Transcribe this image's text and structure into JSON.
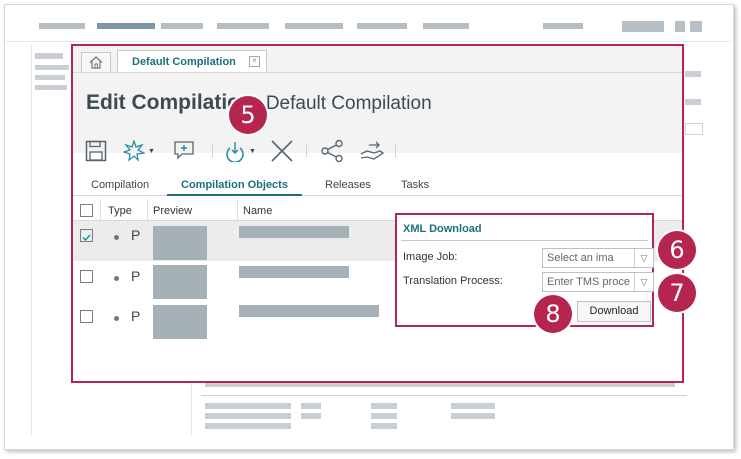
{
  "dialog": {
    "tab_label": "Default Compilation",
    "title_prefix": "Edit Compilation:",
    "title_name": "Default Compilation"
  },
  "toolbar": {
    "icons": [
      "save-icon",
      "new-icon",
      "comment-icon",
      "download-icon",
      "delete-icon",
      "share-icon",
      "handover-icon"
    ]
  },
  "tabs": [
    "Compilation",
    "Compilation Objects",
    "Releases",
    "Tasks"
  ],
  "active_tab": "Compilation Objects",
  "grid": {
    "columns": [
      "Type",
      "Preview",
      "Name"
    ],
    "rows": [
      {
        "checked": true,
        "type": "P"
      },
      {
        "checked": false,
        "type": "P"
      },
      {
        "checked": false,
        "type": "P"
      }
    ]
  },
  "xml_download": {
    "title": "XML Download",
    "image_job_label": "Image Job:",
    "image_job_placeholder": "Select an ima",
    "translation_label": "Translation Process:",
    "translation_placeholder": "Enter TMS proce",
    "download_label": "Download"
  },
  "callouts": [
    "5",
    "6",
    "7",
    "8"
  ],
  "colors": {
    "accent": "#b5254e",
    "teal": "#1d6f7e",
    "placeholder_block": "#a5b0b7"
  }
}
